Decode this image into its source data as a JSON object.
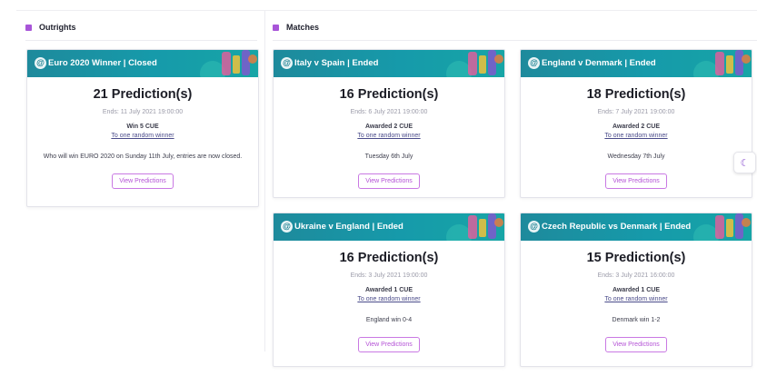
{
  "sections": {
    "outrights": {
      "title": "Outrights"
    },
    "matches": {
      "title": "Matches"
    }
  },
  "colors": {
    "accent": "#a855d8",
    "banner": "#169aaa",
    "button_border": "#c979e3"
  },
  "icons": {
    "banner_logo": "predict-logo-icon",
    "theme_toggle": "moon-icon"
  },
  "outright_cards": [
    {
      "banner": "Euro 2020 Winner | Closed",
      "predictions": "21 Prediction(s)",
      "ends": "Ends: 11 July 2021 19:00:00",
      "award": "Win 5 CUE",
      "winner": "To one random winner",
      "description": "Who will win EURO 2020 on Sunday 11th July, entries are now closed.",
      "button": "View Predictions"
    }
  ],
  "match_cards": [
    {
      "banner": "Italy v Spain | Ended",
      "predictions": "16 Prediction(s)",
      "ends": "Ends: 6 July 2021 19:00:00",
      "award": "Awarded 2 CUE",
      "winner": "To one random winner",
      "description": "Tuesday 6th July",
      "button": "View Predictions"
    },
    {
      "banner": "England v Denmark | Ended",
      "predictions": "18 Prediction(s)",
      "ends": "Ends: 7 July 2021 19:00:00",
      "award": "Awarded 2 CUE",
      "winner": "To one random winner",
      "description": "Wednesday 7th July",
      "button": "View Predictions"
    },
    {
      "banner": "Ukraine v England | Ended",
      "predictions": "16 Prediction(s)",
      "ends": "Ends: 3 July 2021 19:00:00",
      "award": "Awarded 1 CUE",
      "winner": "To one random winner",
      "description": "England win 0-4",
      "button": "View Predictions"
    },
    {
      "banner": "Czech Republic vs Denmark | Ended",
      "predictions": "15 Prediction(s)",
      "ends": "Ends: 3 July 2021 16:00:00",
      "award": "Awarded 1 CUE",
      "winner": "To one random winner",
      "description": "Denmark win 1-2",
      "button": "View Predictions"
    }
  ]
}
